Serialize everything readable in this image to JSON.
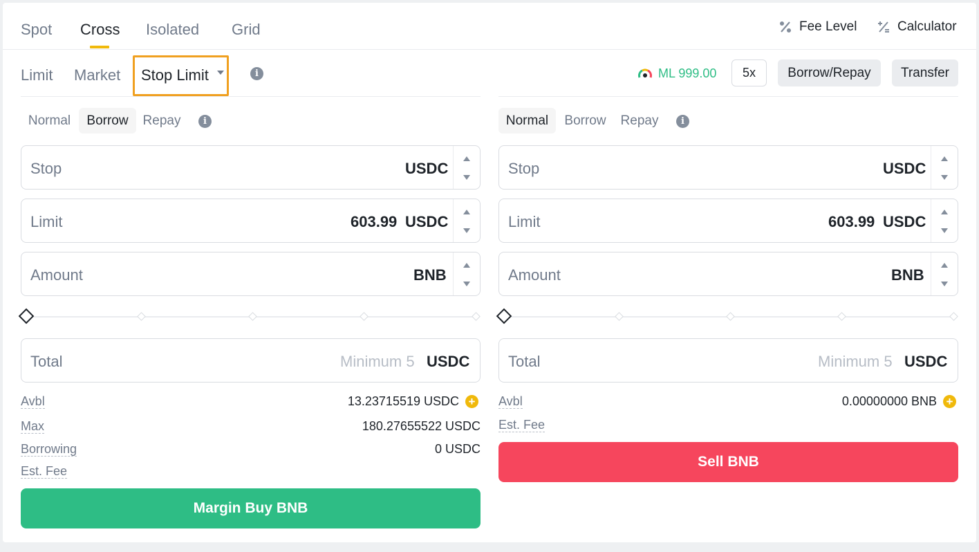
{
  "market_tabs": [
    {
      "label": "Spot"
    },
    {
      "label": "Cross"
    },
    {
      "label": "Isolated"
    },
    {
      "label": "Grid"
    }
  ],
  "active_market_tab": "Cross",
  "top_links": {
    "fee_level": "Fee Level",
    "calculator": "Calculator"
  },
  "order_tabs": {
    "limit": "Limit",
    "market": "Market",
    "stop_limit": "Stop Limit"
  },
  "margin_level": "ML 999.00",
  "leverage": "5x",
  "borrow_repay": "Borrow/Repay",
  "transfer": "Transfer",
  "buy": {
    "modes": [
      "Normal",
      "Borrow",
      "Repay"
    ],
    "active_mode": "Borrow",
    "stop": {
      "label": "Stop",
      "value": "",
      "unit": "USDC"
    },
    "limit": {
      "label": "Limit",
      "value": "603.99",
      "unit": "USDC"
    },
    "amount": {
      "label": "Amount",
      "value": "",
      "unit": "BNB"
    },
    "slider_percent": 0,
    "total": {
      "label": "Total",
      "placeholder": "Minimum 5",
      "unit": "USDC"
    },
    "info": {
      "avbl_label": "Avbl",
      "avbl_value": "13.23715519 USDC",
      "max_label": "Max",
      "max_value": "180.27655522 USDC",
      "borrowing_label": "Borrowing",
      "borrowing_value": "0 USDC",
      "fee_label": "Est. Fee"
    },
    "button": "Margin Buy BNB"
  },
  "sell": {
    "modes": [
      "Normal",
      "Borrow",
      "Repay"
    ],
    "active_mode": "Normal",
    "stop": {
      "label": "Stop",
      "value": "",
      "unit": "USDC"
    },
    "limit": {
      "label": "Limit",
      "value": "603.99",
      "unit": "USDC"
    },
    "amount": {
      "label": "Amount",
      "value": "",
      "unit": "BNB"
    },
    "slider_percent": 0,
    "total": {
      "label": "Total",
      "placeholder": "Minimum 5",
      "unit": "USDC"
    },
    "info": {
      "avbl_label": "Avbl",
      "avbl_value": "0.00000000 BNB",
      "fee_label": "Est. Fee"
    },
    "button": "Sell BNB"
  },
  "colors": {
    "accent": "#f0b90b",
    "buy": "#2ebd85",
    "sell": "#f6465d",
    "highlight": "#f0a020"
  }
}
